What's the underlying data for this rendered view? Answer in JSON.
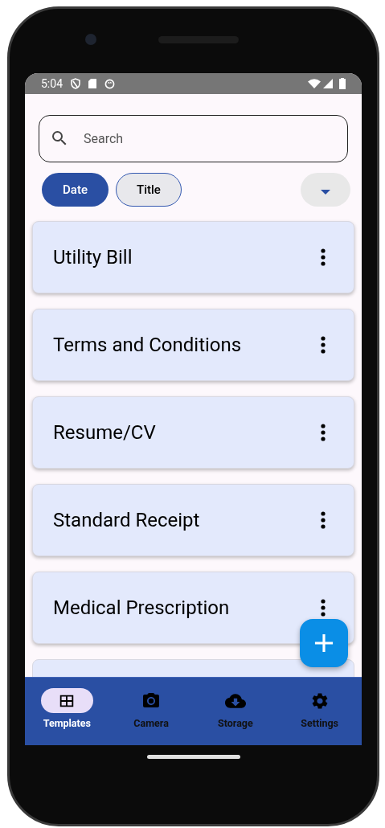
{
  "status_bar": {
    "time": "5:04"
  },
  "search": {
    "placeholder": "Search"
  },
  "sort_chips": [
    {
      "label": "Date",
      "selected": true
    },
    {
      "label": "Title",
      "selected": false
    }
  ],
  "templates": [
    {
      "title": "Utility Bill"
    },
    {
      "title": "Terms and Conditions"
    },
    {
      "title": "Resume/CV"
    },
    {
      "title": "Standard Receipt"
    },
    {
      "title": "Medical Prescription"
    }
  ],
  "nav": [
    {
      "kind": "templates",
      "label": "Templates",
      "selected": true
    },
    {
      "kind": "camera",
      "label": "Camera",
      "selected": false
    },
    {
      "kind": "storage",
      "label": "Storage",
      "selected": false
    },
    {
      "kind": "settings",
      "label": "Settings",
      "selected": false
    }
  ]
}
